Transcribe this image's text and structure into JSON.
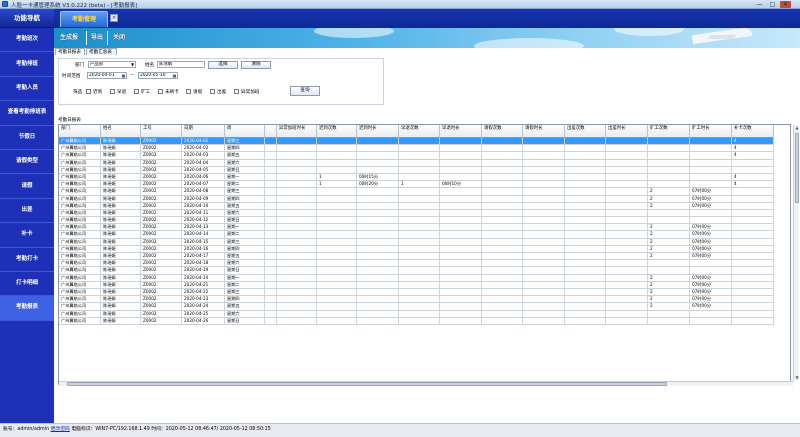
{
  "window": {
    "title": "人脸一卡通管理系统 V3.0.222 (beta) - [考勤报表]",
    "btn_min": "—",
    "btn_max": "□",
    "btn_close": "✕"
  },
  "sidebar": {
    "header": "功能导航",
    "items": [
      {
        "label": "考勤班次"
      },
      {
        "label": "考勤排班"
      },
      {
        "label": "考勤人员"
      },
      {
        "label": "查看考勤排班表"
      },
      {
        "label": "节假日"
      },
      {
        "label": "请假类型"
      },
      {
        "label": "请假"
      },
      {
        "label": "出差"
      },
      {
        "label": "补卡"
      },
      {
        "label": "考勤打卡"
      },
      {
        "label": "打卡明细"
      },
      {
        "label": "考勤报表"
      }
    ]
  },
  "tabs": {
    "active": "考勤管理",
    "close": "×"
  },
  "toolbar": {
    "generate": "生成报表",
    "export": "导出",
    "close": "关闭"
  },
  "subtabs": [
    "考勤日报表",
    "考勤汇总表"
  ],
  "filters": {
    "dept_label": "部门",
    "dept_value": "产品部",
    "name_label": "姓名",
    "name_value": "陈瑶娟",
    "select_btn": "选择",
    "clear_btn": "清除",
    "time_label": "时间范围",
    "date_from": "2020-04-01",
    "date_sep": "—",
    "date_to": "2020-05-10",
    "screen_label": "筛选",
    "checks": [
      "迟到",
      "早退",
      "旷工",
      "未刷卡",
      "请假",
      "出差",
      "异常加班"
    ],
    "query_btn": "查询"
  },
  "report": {
    "title": "考勤日报表",
    "columns": [
      "部门",
      "姓名",
      "工号",
      "日期",
      "周",
      "",
      "异常加班时长",
      "迟到次数",
      "迟到时长",
      "早退次数",
      "早退时长",
      "请假次数",
      "请假时长",
      "出差次数",
      "出差时长",
      "旷工次数",
      "旷工时长",
      "补卡次数"
    ],
    "rows": [
      [
        "广州翼皓公司",
        "陈瑶娟",
        "Z0002",
        "2020-04-01",
        "星期三",
        "",
        "",
        "",
        "",
        "",
        "",
        "",
        "",
        "",
        "",
        "",
        "",
        "4"
      ],
      [
        "广州翼皓公司",
        "陈瑶娟",
        "Z0002",
        "2020-04-02",
        "星期四",
        "",
        "",
        "",
        "",
        "",
        "",
        "",
        "",
        "",
        "",
        "",
        "",
        "4"
      ],
      [
        "广州翼皓公司",
        "陈瑶娟",
        "Z0002",
        "2020-04-03",
        "星期五",
        "",
        "",
        "",
        "",
        "",
        "",
        "",
        "",
        "",
        "",
        "",
        "",
        "4"
      ],
      [
        "广州翼皓公司",
        "陈瑶娟",
        "Z0002",
        "2020-04-04",
        "星期六",
        "",
        "",
        "",
        "",
        "",
        "",
        "",
        "",
        "",
        "",
        "",
        "",
        ""
      ],
      [
        "广州翼皓公司",
        "陈瑶娟",
        "Z0002",
        "2020-04-05",
        "星期日",
        "",
        "",
        "",
        "",
        "",
        "",
        "",
        "",
        "",
        "",
        "",
        "",
        ""
      ],
      [
        "广州翼皓公司",
        "陈瑶娟",
        "Z0002",
        "2020-04-06",
        "星期一",
        "",
        "",
        "1",
        "00时15分",
        "",
        "",
        "",
        "",
        "",
        "",
        "",
        "",
        "4"
      ],
      [
        "广州翼皓公司",
        "陈瑶娟",
        "Z0002",
        "2020-04-07",
        "星期二",
        "",
        "",
        "1",
        "00时20分",
        "1",
        "00时10分",
        "",
        "",
        "",
        "",
        "",
        "",
        "4"
      ],
      [
        "广州翼皓公司",
        "陈瑶娟",
        "Z0002",
        "2020-04-08",
        "星期三",
        "",
        "",
        "",
        "",
        "",
        "",
        "",
        "",
        "",
        "",
        "2",
        "07时00分",
        ""
      ],
      [
        "广州翼皓公司",
        "陈瑶娟",
        "Z0002",
        "2020-04-09",
        "星期四",
        "",
        "",
        "",
        "",
        "",
        "",
        "",
        "",
        "",
        "",
        "2",
        "07时00分",
        ""
      ],
      [
        "广州翼皓公司",
        "陈瑶娟",
        "Z0002",
        "2020-04-10",
        "星期五",
        "",
        "",
        "",
        "",
        "",
        "",
        "",
        "",
        "",
        "",
        "2",
        "07时00分",
        ""
      ],
      [
        "广州翼皓公司",
        "陈瑶娟",
        "Z0002",
        "2020-04-11",
        "星期六",
        "",
        "",
        "",
        "",
        "",
        "",
        "",
        "",
        "",
        "",
        "",
        "",
        ""
      ],
      [
        "广州翼皓公司",
        "陈瑶娟",
        "Z0002",
        "2020-04-12",
        "星期日",
        "",
        "",
        "",
        "",
        "",
        "",
        "",
        "",
        "",
        "",
        "",
        "",
        ""
      ],
      [
        "广州翼皓公司",
        "陈瑶娟",
        "Z0002",
        "2020-04-13",
        "星期一",
        "",
        "",
        "",
        "",
        "",
        "",
        "",
        "",
        "",
        "",
        "2",
        "07时00分",
        ""
      ],
      [
        "广州翼皓公司",
        "陈瑶娟",
        "Z0002",
        "2020-04-14",
        "星期二",
        "",
        "",
        "",
        "",
        "",
        "",
        "",
        "",
        "",
        "",
        "2",
        "07时00分",
        ""
      ],
      [
        "广州翼皓公司",
        "陈瑶娟",
        "Z0002",
        "2020-04-15",
        "星期三",
        "",
        "",
        "",
        "",
        "",
        "",
        "",
        "",
        "",
        "",
        "2",
        "07时00分",
        ""
      ],
      [
        "广州翼皓公司",
        "陈瑶娟",
        "Z0002",
        "2020-04-16",
        "星期四",
        "",
        "",
        "",
        "",
        "",
        "",
        "",
        "",
        "",
        "",
        "2",
        "07时00分",
        ""
      ],
      [
        "广州翼皓公司",
        "陈瑶娟",
        "Z0002",
        "2020-04-17",
        "星期五",
        "",
        "",
        "",
        "",
        "",
        "",
        "",
        "",
        "",
        "",
        "2",
        "07时00分",
        ""
      ],
      [
        "广州翼皓公司",
        "陈瑶娟",
        "Z0002",
        "2020-04-18",
        "星期六",
        "",
        "",
        "",
        "",
        "",
        "",
        "",
        "",
        "",
        "",
        "",
        "",
        ""
      ],
      [
        "广州翼皓公司",
        "陈瑶娟",
        "Z0002",
        "2020-04-19",
        "星期日",
        "",
        "",
        "",
        "",
        "",
        "",
        "",
        "",
        "",
        "",
        "",
        "",
        ""
      ],
      [
        "广州翼皓公司",
        "陈瑶娟",
        "Z0002",
        "2020-04-20",
        "星期一",
        "",
        "",
        "",
        "",
        "",
        "",
        "",
        "",
        "",
        "",
        "2",
        "07时00分",
        ""
      ],
      [
        "广州翼皓公司",
        "陈瑶娟",
        "Z0002",
        "2020-04-21",
        "星期二",
        "",
        "",
        "",
        "",
        "",
        "",
        "",
        "",
        "",
        "",
        "2",
        "07时00分",
        ""
      ],
      [
        "广州翼皓公司",
        "陈瑶娟",
        "Z0002",
        "2020-04-22",
        "星期三",
        "",
        "",
        "",
        "",
        "",
        "",
        "",
        "",
        "",
        "",
        "2",
        "07时00分",
        ""
      ],
      [
        "广州翼皓公司",
        "陈瑶娟",
        "Z0002",
        "2020-04-23",
        "星期四",
        "",
        "",
        "",
        "",
        "",
        "",
        "",
        "",
        "",
        "",
        "2",
        "07时00分",
        ""
      ],
      [
        "广州翼皓公司",
        "陈瑶娟",
        "Z0002",
        "2020-04-24",
        "星期五",
        "",
        "",
        "",
        "",
        "",
        "",
        "",
        "",
        "",
        "",
        "2",
        "07时00分",
        ""
      ],
      [
        "广州翼皓公司",
        "陈瑶娟",
        "Z0002",
        "2020-04-25",
        "星期六",
        "",
        "",
        "",
        "",
        "",
        "",
        "",
        "",
        "",
        "",
        "",
        "",
        ""
      ],
      [
        "广州翼皓公司",
        "陈瑶娟",
        "Z0002",
        "2020-04-26",
        "星期日",
        "",
        "",
        "",
        "",
        "",
        "",
        "",
        "",
        "",
        "",
        "",
        "",
        ""
      ]
    ]
  },
  "status": {
    "account_label": "账号：",
    "account": "admin/admin",
    "change_pwd": "更改密码",
    "pc_label": "电脑标识：",
    "pc": "WIN7-PC/192.168.1.49",
    "time_label": "时间：",
    "time_value": "2020-05-12 08:46:47/ 2020-05-12 08:50:15"
  },
  "colors": {
    "sidebar": "#1e2fb8",
    "selected_row": "#3399ff",
    "tab_text": "#ffd84a"
  }
}
